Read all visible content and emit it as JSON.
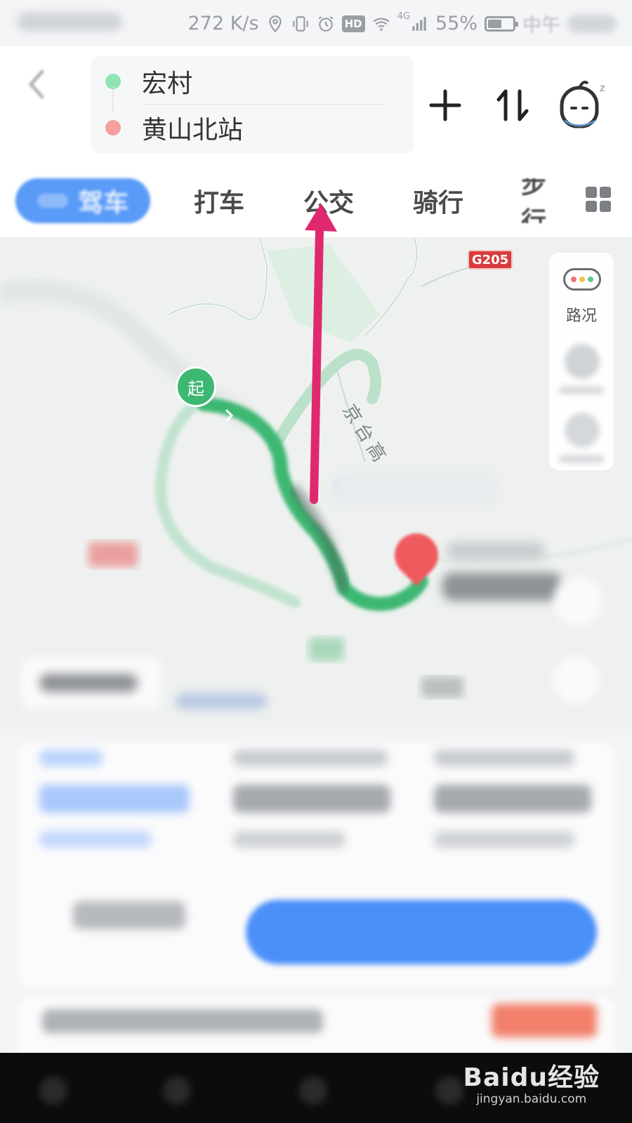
{
  "status_bar": {
    "net_speed": "272 K/s",
    "hd_badge": "HD",
    "signal_tag": "4G",
    "battery_text": "55%",
    "battery_level": 0.55,
    "time_fragment": "中午"
  },
  "header": {
    "origin": "宏村",
    "destination": "黄山北站"
  },
  "tabs": {
    "drive": "驾车",
    "taxi": "打车",
    "bus": "公交",
    "bike": "骑行",
    "walk": "步行"
  },
  "map": {
    "highway_badge": "G205",
    "road_name": "京台高",
    "start_marker": "起",
    "traffic_label": "路况",
    "colors": {
      "route_primary": "#3db873",
      "route_alt": "#9fd8b6",
      "annotation_arrow": "#e0286f"
    }
  },
  "watermark": {
    "brand": "Baidu经验",
    "url": "jingyan.baidu.com"
  },
  "accent_color": "#4b8ff8"
}
